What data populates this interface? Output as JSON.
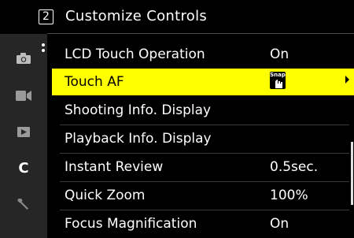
{
  "header": {
    "page_number": "2",
    "title": "Customize Controls"
  },
  "sidebar": {
    "items": [
      {
        "icon": "camera-icon"
      },
      {
        "icon": "video-icon"
      },
      {
        "icon": "playback-icon"
      },
      {
        "icon": "custom-c-icon",
        "label": "C"
      },
      {
        "icon": "wrench-icon"
      }
    ]
  },
  "menu": {
    "items": [
      {
        "label": "LCD Touch Operation",
        "value": "On"
      },
      {
        "label": "Touch AF",
        "value_icon": "snap-icon",
        "value_icon_text": "Snap"
      },
      {
        "label": "Shooting Info. Display",
        "value": ""
      },
      {
        "label": "Playback Info. Display",
        "value": ""
      },
      {
        "label": "Instant Review",
        "value": "0.5sec."
      },
      {
        "label": "Quick Zoom",
        "value": "100%"
      },
      {
        "label": "Focus Magnification",
        "value": "On"
      }
    ],
    "selected_index": 1
  },
  "colors": {
    "highlight": "#ffff00",
    "background": "#000000",
    "sidebar": "#262626"
  }
}
